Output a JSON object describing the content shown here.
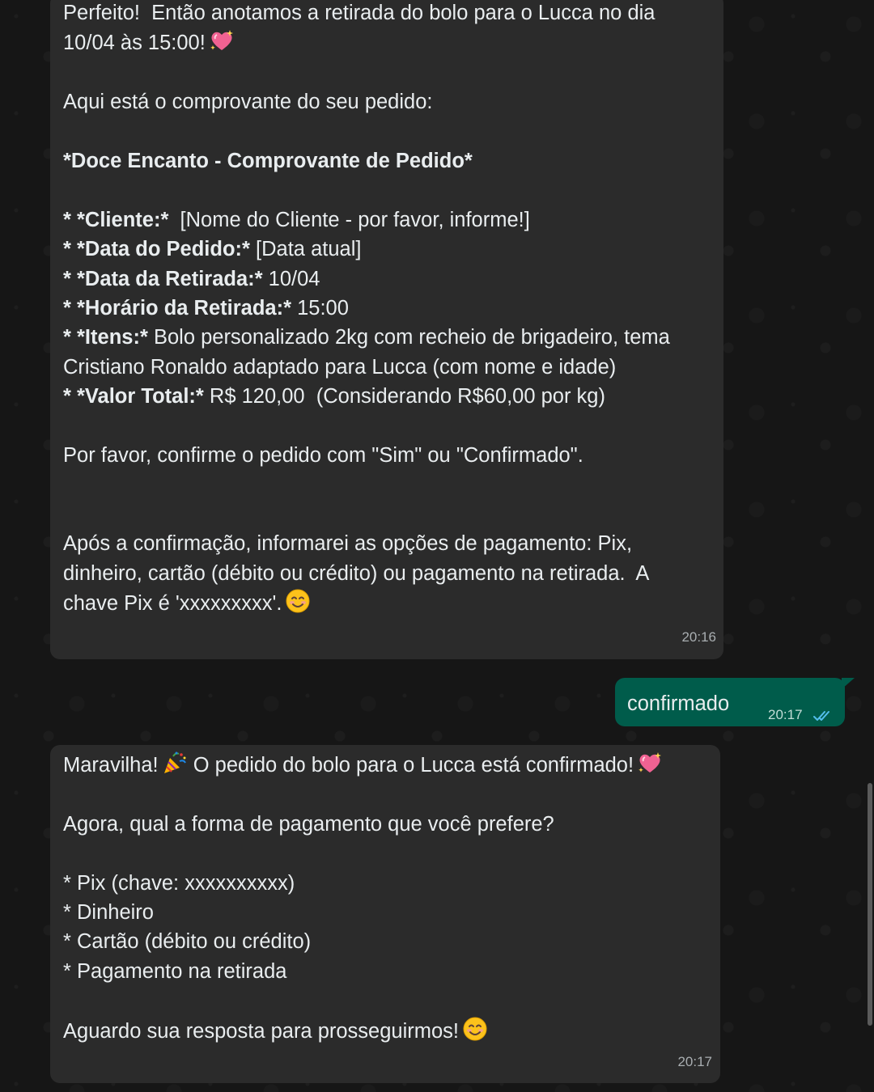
{
  "messages": {
    "m1": {
      "l1": "Perfeito!  Então anotamos a retirada do bolo para o Lucca no dia",
      "l2": "10/04 às 15:00!",
      "l3": "Aqui está o comprovante do seu pedido:",
      "l4": "*Doce Encanto - Comprovante de Pedido*",
      "l5a": "* *Cliente:*",
      "l5b": "  [Nome do Cliente - por favor, informe!]",
      "l6a": "* *Data do Pedido:*",
      "l6b": " [Data atual]",
      "l7a": "* *Data da Retirada:*",
      "l7b": " 10/04",
      "l8a": "* *Horário da Retirada:*",
      "l8b": " 15:00",
      "l9a": "* *Itens:*",
      "l9b": " Bolo personalizado 2kg com recheio de brigadeiro, tema",
      "l10": "Cristiano Ronaldo adaptado para Lucca (com nome e idade)",
      "l11a": "* *Valor Total:*",
      "l11b": " R$ 120,00  (Considerando R$60,00 por kg)",
      "l12": "Por favor, confirme o pedido com \"Sim\" ou \"Confirmado\".",
      "l13": "Após a confirmação, informarei as opções de pagamento: Pix,",
      "l14": "dinheiro, cartão (débito ou crédito) ou pagamento na retirada.  A",
      "l15": "chave Pix é 'xxxxxxxxx'.",
      "time": "20:16"
    },
    "m2": {
      "text": "confirmado",
      "time": "20:17"
    },
    "m3": {
      "l1": "Maravilha!",
      "l1b": " O pedido do bolo para o Lucca está confirmado!",
      "l2": "Agora, qual a forma de pagamento que você prefere?",
      "l3": "* Pix (chave: xxxxxxxxxx)",
      "l4": "* Dinheiro",
      "l5": "* Cartão (débito ou crédito)",
      "l6": "* Pagamento na retirada",
      "l7": "Aguardo sua resposta para prosseguirmos!",
      "time": "20:17"
    }
  },
  "icons": {
    "heart": "sparkling-heart-icon",
    "smile": "smiling-face-icon",
    "party": "party-popper-icon",
    "ticks": "double-check-read-icon"
  },
  "colors": {
    "incoming_bubble": "#2b2b2b",
    "outgoing_bubble": "#005c4b",
    "read_ticks": "#53bdeb"
  }
}
